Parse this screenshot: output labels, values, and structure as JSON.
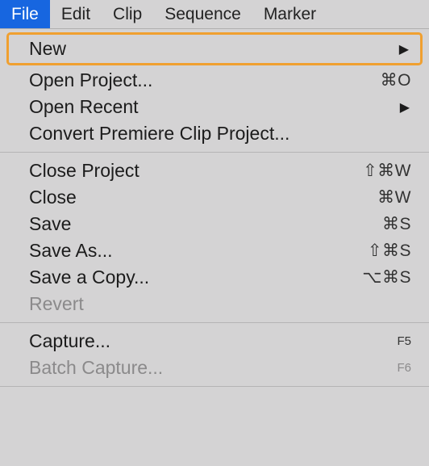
{
  "menubar": {
    "file": "File",
    "edit": "Edit",
    "clip": "Clip",
    "sequence": "Sequence",
    "marker": "Marker"
  },
  "file_menu": {
    "new": "New",
    "open_project": "Open Project...",
    "open_project_sc": "⌘O",
    "open_recent": "Open Recent",
    "convert": "Convert Premiere Clip Project...",
    "close_project": "Close Project",
    "close_project_sc": "⇧⌘W",
    "close": "Close",
    "close_sc": "⌘W",
    "save": "Save",
    "save_sc": "⌘S",
    "save_as": "Save As...",
    "save_as_sc": "⇧⌘S",
    "save_copy": "Save a Copy...",
    "save_copy_sc": "⌥⌘S",
    "revert": "Revert",
    "capture": "Capture...",
    "capture_sc": "F5",
    "batch_capture": "Batch Capture...",
    "batch_capture_sc": "F6"
  }
}
